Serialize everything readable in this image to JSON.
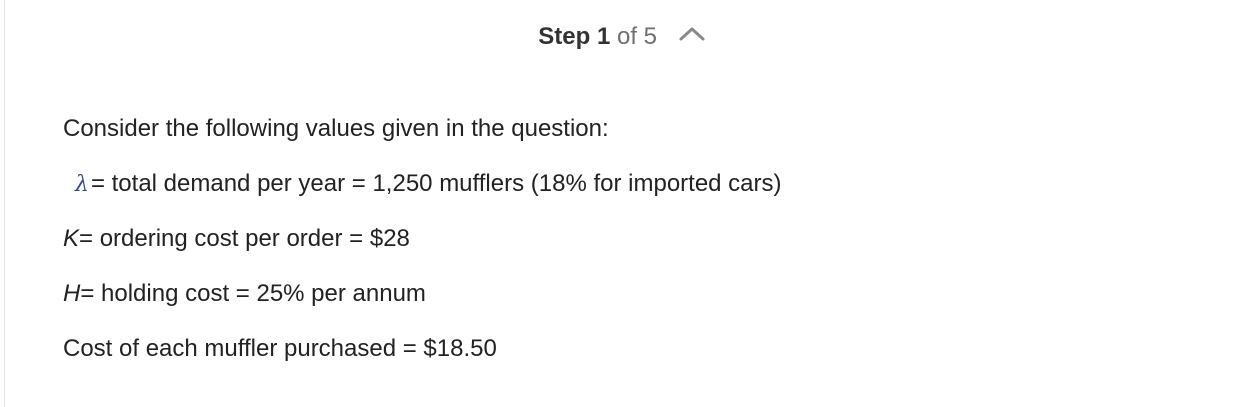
{
  "header": {
    "step_word": "Step",
    "step_current": "1",
    "step_of": "of 5",
    "chevron_icon": "chevron-up-icon"
  },
  "content": {
    "intro": "Consider the following values given in the question:",
    "lambda_symbol": "λ",
    "lambda_text": "= total demand per year = 1,250 mufflers (18% for imported cars)",
    "k_symbol": "K",
    "k_text": "= ordering cost per order = $28",
    "h_symbol": "H",
    "h_text": "= holding cost = 25% per annum",
    "cost_text": "Cost of each muffler purchased = $18.50"
  },
  "colors": {
    "text": "#222222",
    "muted": "#6f6f6f",
    "lambda": "#3b4a8c",
    "border": "#e3e3e3"
  }
}
